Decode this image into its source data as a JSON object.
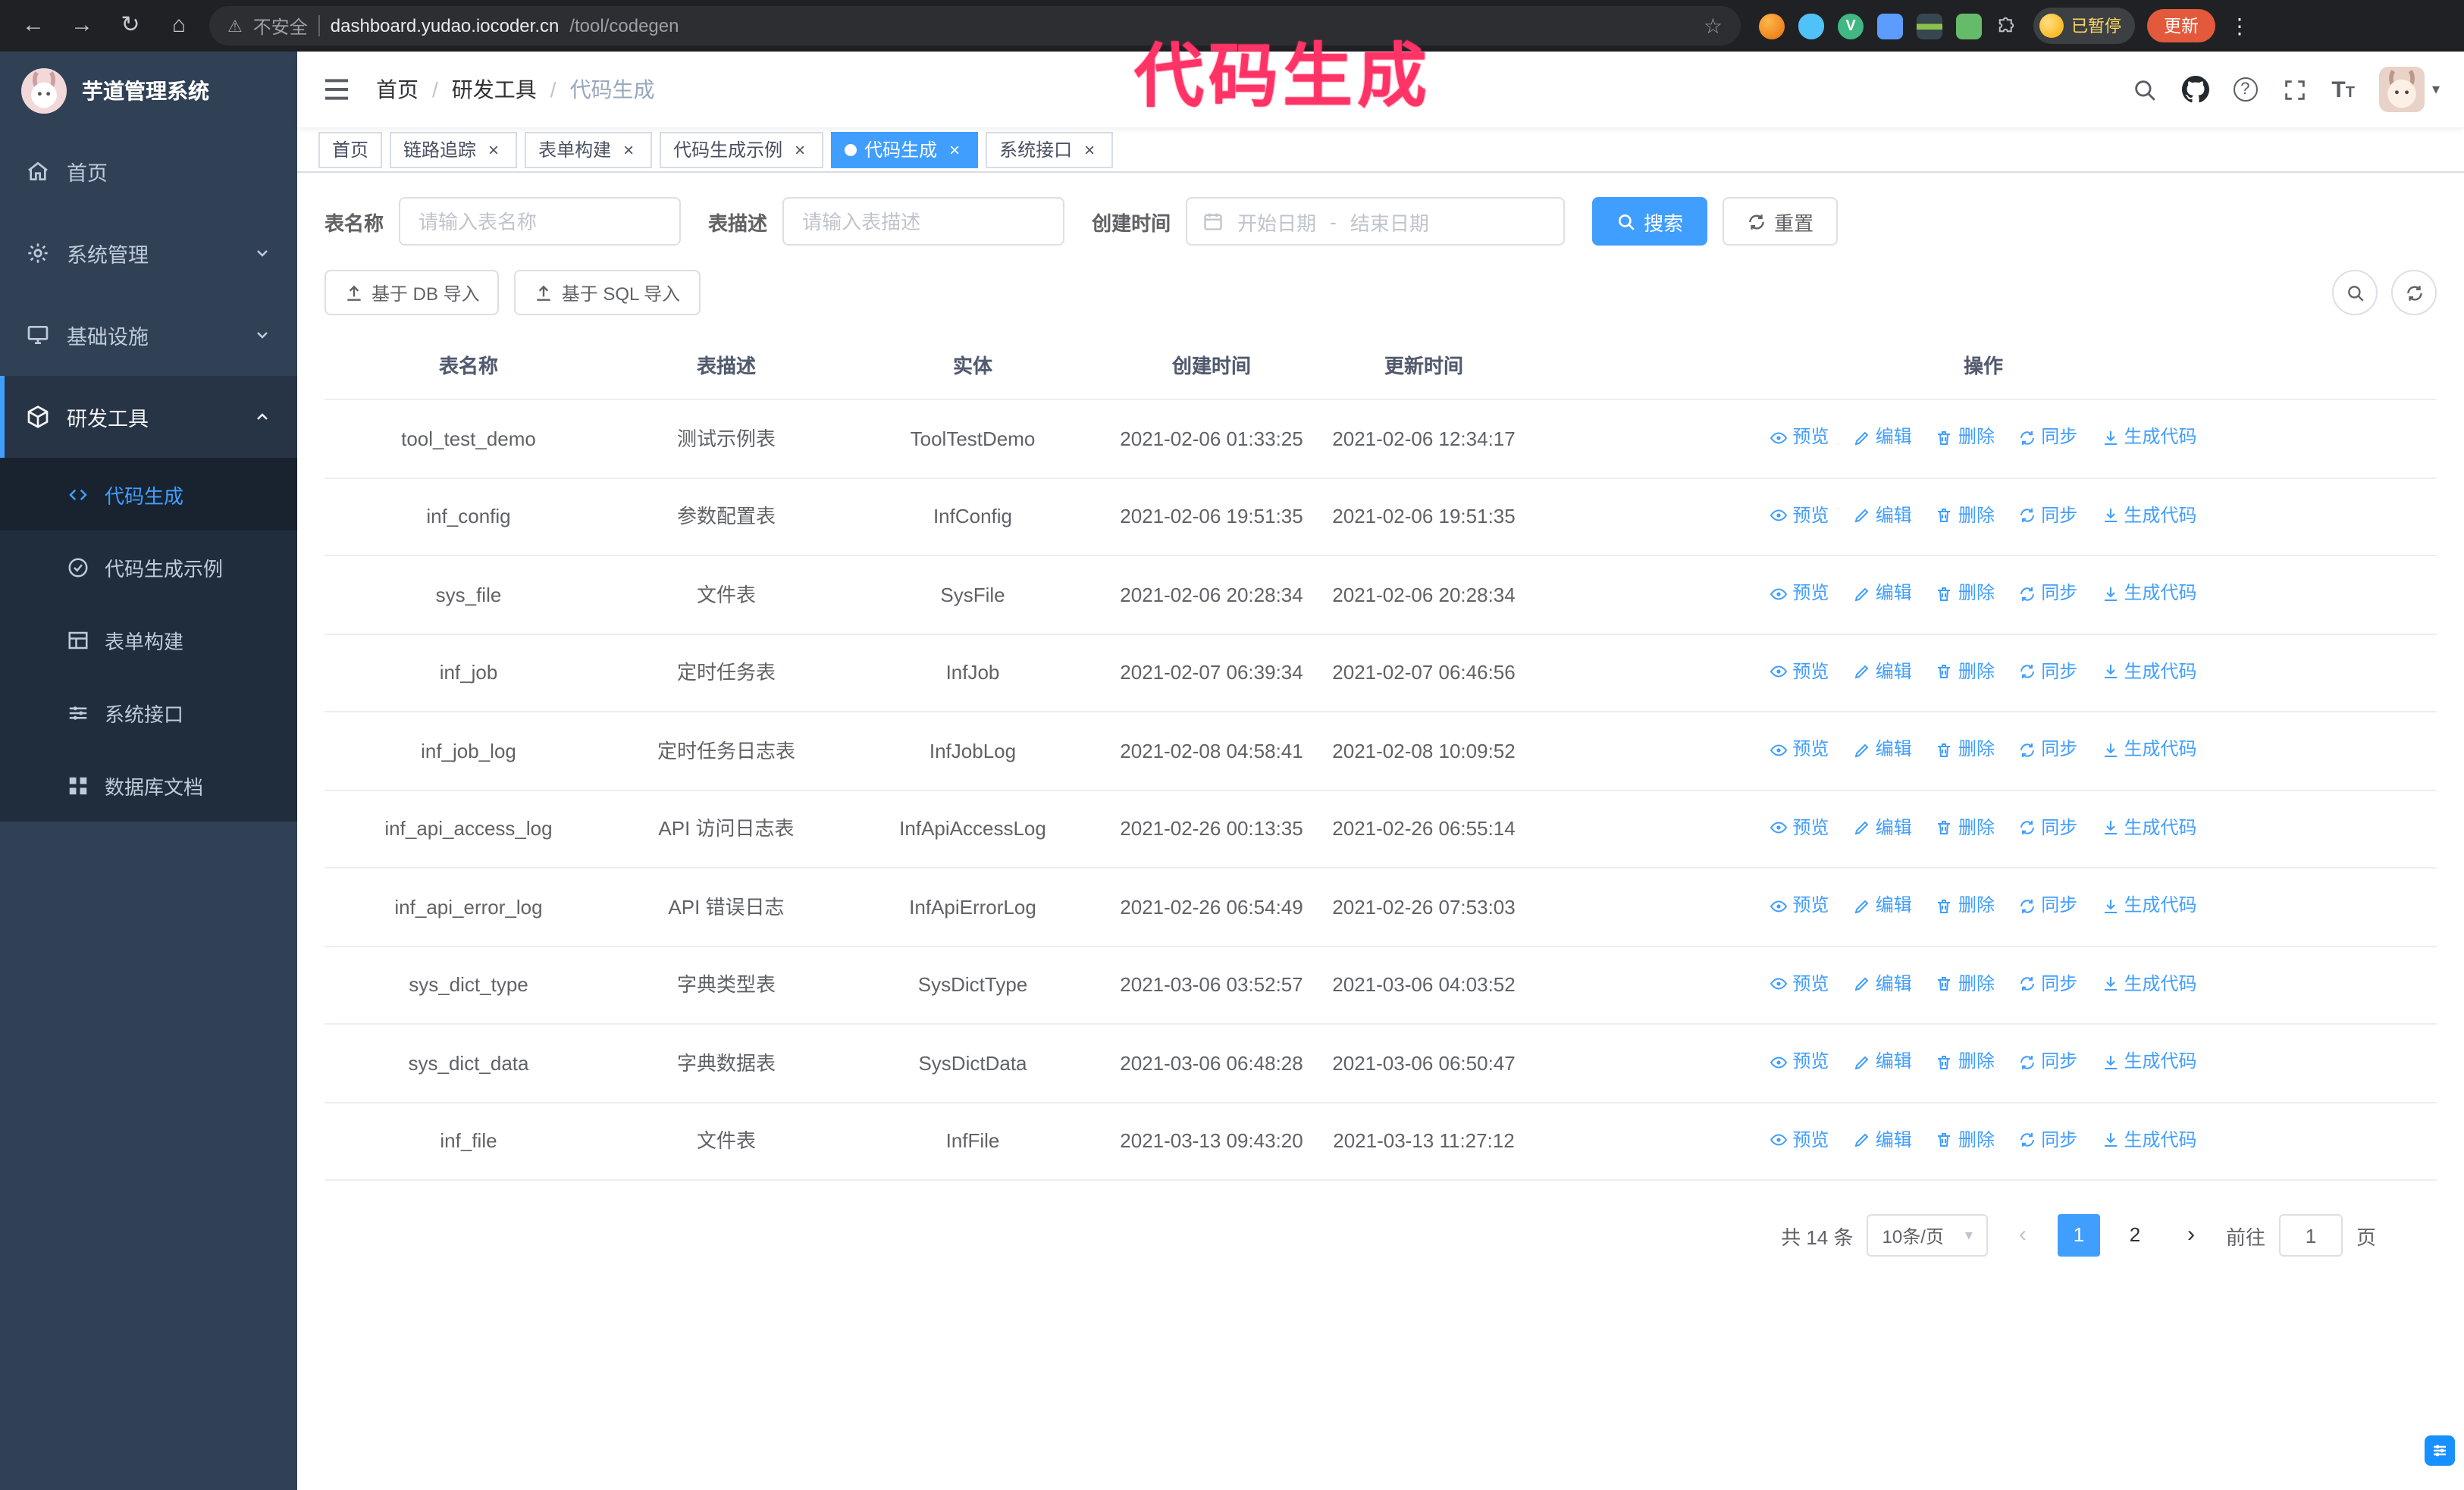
{
  "annotation": {
    "text": "代码生成"
  },
  "browser": {
    "security_warning": "不安全",
    "url_host": "dashboard.yudao.iocoder.cn",
    "url_path": "/tool/codegen",
    "profile_badge": "已暂停",
    "update_button": "更新"
  },
  "icons": {
    "back": "←",
    "forward": "→",
    "reload": "↻",
    "home": "⌂",
    "warning": "⚠",
    "star": "☆",
    "kebab": "⋮",
    "vue": "V",
    "close": "×",
    "caret_down": "▾",
    "question": "?",
    "font_big": "T",
    "font_small": "T",
    "prev": "‹",
    "next": "›",
    "separator": "/"
  },
  "sidebar": {
    "logo_title": "芋道管理系统",
    "items": [
      {
        "label": "首页"
      },
      {
        "label": "系统管理"
      },
      {
        "label": "基础设施"
      },
      {
        "label": "研发工具"
      }
    ],
    "submenu": [
      {
        "label": "代码生成"
      },
      {
        "label": "代码生成示例"
      },
      {
        "label": "表单构建"
      },
      {
        "label": "系统接口"
      },
      {
        "label": "数据库文档"
      }
    ]
  },
  "header": {
    "breadcrumb": [
      "首页",
      "研发工具",
      "代码生成"
    ]
  },
  "tabs": [
    {
      "label": "首页"
    },
    {
      "label": "链路追踪"
    },
    {
      "label": "表单构建"
    },
    {
      "label": "代码生成示例"
    },
    {
      "label": "代码生成"
    },
    {
      "label": "系统接口"
    }
  ],
  "filters": {
    "table_name_label": "表名称",
    "table_name_placeholder": "请输入表名称",
    "table_desc_label": "表描述",
    "table_desc_placeholder": "请输入表描述",
    "create_time_label": "创建时间",
    "start_date_placeholder": "开始日期",
    "range_separator": "-",
    "end_date_placeholder": "结束日期",
    "search_button": "搜索",
    "reset_button": "重置"
  },
  "toolbar": {
    "import_db_button": "基于 DB 导入",
    "import_sql_button": "基于 SQL 导入"
  },
  "table": {
    "columns": [
      "表名称",
      "表描述",
      "实体",
      "创建时间",
      "更新时间",
      "操作"
    ],
    "actions": [
      "预览",
      "编辑",
      "删除",
      "同步",
      "生成代码"
    ],
    "rows": [
      {
        "name": "tool_test_demo",
        "desc": "测试示例表",
        "entity": "ToolTestDemo",
        "created": "2021-02-06 01:33:25",
        "updated": "2021-02-06 12:34:17"
      },
      {
        "name": "inf_config",
        "desc": "参数配置表",
        "entity": "InfConfig",
        "created": "2021-02-06 19:51:35",
        "updated": "2021-02-06 19:51:35"
      },
      {
        "name": "sys_file",
        "desc": "文件表",
        "entity": "SysFile",
        "created": "2021-02-06 20:28:34",
        "updated": "2021-02-06 20:28:34"
      },
      {
        "name": "inf_job",
        "desc": "定时任务表",
        "entity": "InfJob",
        "created": "2021-02-07 06:39:34",
        "updated": "2021-02-07 06:46:56"
      },
      {
        "name": "inf_job_log",
        "desc": "定时任务日志表",
        "entity": "InfJobLog",
        "created": "2021-02-08 04:58:41",
        "updated": "2021-02-08 10:09:52"
      },
      {
        "name": "inf_api_access_log",
        "desc": "API 访问日志表",
        "entity": "InfApiAccessLog",
        "created": "2021-02-26 00:13:35",
        "updated": "2021-02-26 06:55:14"
      },
      {
        "name": "inf_api_error_log",
        "desc": "API 错误日志",
        "entity": "InfApiErrorLog",
        "created": "2021-02-26 06:54:49",
        "updated": "2021-02-26 07:53:03"
      },
      {
        "name": "sys_dict_type",
        "desc": "字典类型表",
        "entity": "SysDictType",
        "created": "2021-03-06 03:52:57",
        "updated": "2021-03-06 04:03:52"
      },
      {
        "name": "sys_dict_data",
        "desc": "字典数据表",
        "entity": "SysDictData",
        "created": "2021-03-06 06:48:28",
        "updated": "2021-03-06 06:50:47"
      },
      {
        "name": "inf_file",
        "desc": "文件表",
        "entity": "InfFile",
        "created": "2021-03-13 09:43:20",
        "updated": "2021-03-13 11:27:12"
      }
    ]
  },
  "pagination": {
    "total": "共 14 条",
    "page_size": "10条/页",
    "pages": [
      "1",
      "2"
    ],
    "goto_label": "前往",
    "goto_value": "1",
    "page_label": "页"
  }
}
